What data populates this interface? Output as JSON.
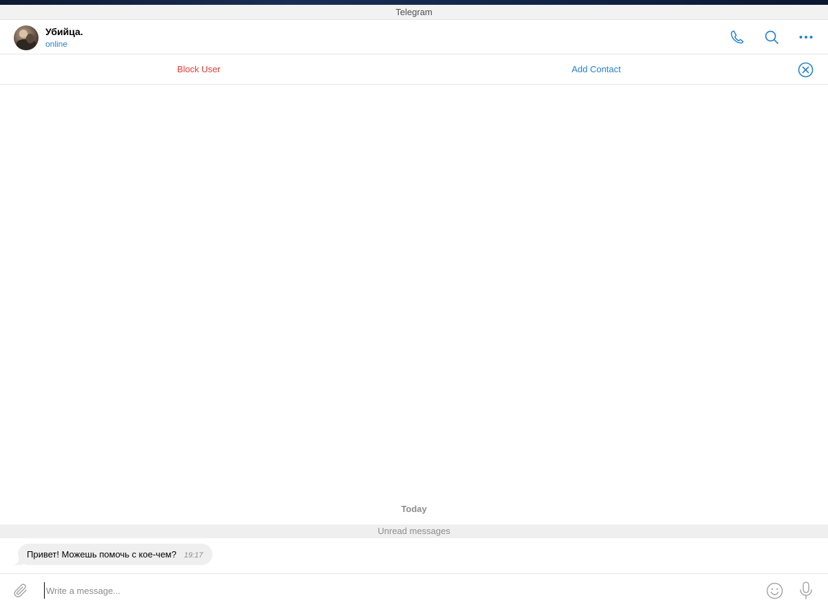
{
  "window": {
    "title": "Telegram"
  },
  "header": {
    "contact_name": "Убийца.",
    "status": "online",
    "icons": [
      "phone-icon",
      "search-icon",
      "more-icon"
    ]
  },
  "action_bar": {
    "block_label": "Block User",
    "add_contact_label": "Add Contact",
    "close_icon": "close-circle-icon"
  },
  "messages": {
    "date_separator": "Today",
    "unread_label": "Unread messages",
    "items": [
      {
        "text": "Привет! Можешь помочь с кое-чем?",
        "time": "19:17"
      }
    ]
  },
  "composer": {
    "placeholder": "Write a message...",
    "icons": [
      "paperclip-icon",
      "emoji-icon",
      "microphone-icon"
    ]
  },
  "colors": {
    "accent": "#2481cc",
    "danger": "#e53935",
    "muted": "#8c8c8c",
    "bubble": "#efefef"
  }
}
